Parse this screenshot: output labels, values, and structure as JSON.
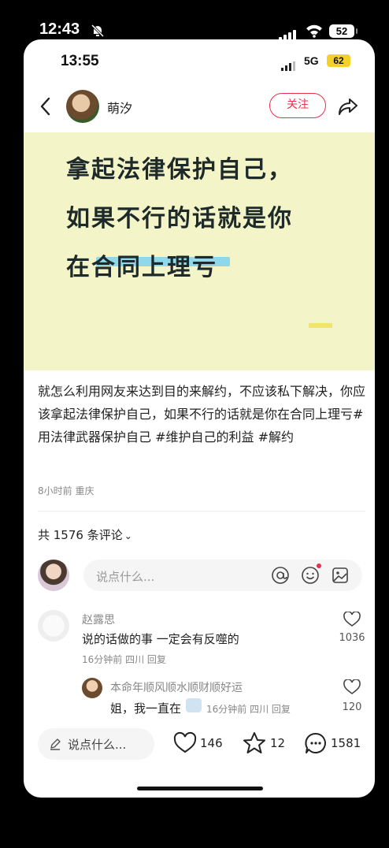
{
  "outer_status": {
    "time": "12:43",
    "battery": "52"
  },
  "inner_status": {
    "time": "13:55",
    "network": "5G",
    "battery": "62"
  },
  "nav": {
    "author": "萌汐",
    "follow_label": "关注"
  },
  "hero": {
    "lines": [
      "拿起法律保护自己，",
      "如果不行的话就是你",
      "在合同上理亏"
    ],
    "background": "#f3f4c8",
    "highlight": "#8fd8ea"
  },
  "post": {
    "description": "就怎么利用网友来达到目的来解约，不应该私下解决，你应该拿起法律保护自己，如果不行的话就是你在合同上理亏#用法律武器保护自己 #维护自己的利益 #解约",
    "meta": "8小时前 重庆"
  },
  "comments_header": {
    "label": "共 1576 条评论",
    "chevron": "⌄"
  },
  "comment_input": {
    "placeholder": "说点什么..."
  },
  "comments": [
    {
      "user": "赵露思",
      "text": "说的话做的事 一定会有反噬的",
      "meta": "16分钟前 四川 回复",
      "likes": "1036"
    },
    {
      "user": "本命年顺风顺水顺财顺好运",
      "text": "姐，我一直在",
      "meta": "16分钟前 四川 回复",
      "likes": "120"
    }
  ],
  "bottom_bar": {
    "placeholder": "说点什么...",
    "likes": "146",
    "stars": "12",
    "comments": "1581"
  },
  "accent_color": "#e8304a"
}
